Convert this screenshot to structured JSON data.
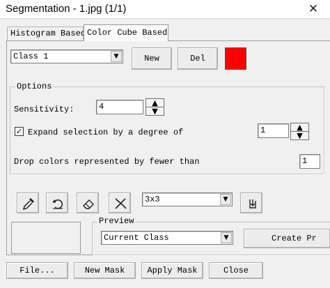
{
  "window": {
    "title": "Segmentation - 1.jpg (1/1)",
    "close_glyph": "✕"
  },
  "tabs": [
    {
      "label": "Histogram Based",
      "active": false
    },
    {
      "label": "Color Cube Based",
      "active": true
    }
  ],
  "class_selector": {
    "value": "Class 1"
  },
  "buttons": {
    "new": "New",
    "del": "Del"
  },
  "class_color": "#ff0000",
  "options": {
    "group_label": "Options",
    "sensitivity_label": "Sensitivity:",
    "sensitivity_value": "4",
    "expand_checked": true,
    "expand_label": "Expand selection by a degree of",
    "expand_value": "1",
    "drop_label": "Drop colors represented by fewer than",
    "drop_value": "1"
  },
  "toolbar": {
    "tools": [
      "eyedropper-icon",
      "undo-icon",
      "eraser-icon",
      "scissors-icon"
    ],
    "kernel_size": "3x3",
    "export_icon": "export-icon"
  },
  "preview": {
    "group_label": "Preview",
    "mode": "Current Class",
    "create_button": "Create Pr"
  },
  "bottom_buttons": {
    "file": "File...",
    "new_mask": "New Mask",
    "apply_mask": "Apply Mask",
    "close": "Close"
  },
  "icons": {
    "spinner_up": "▲",
    "spinner_down": "▼",
    "combo_arrow": "▼",
    "checkmark": "✓"
  }
}
